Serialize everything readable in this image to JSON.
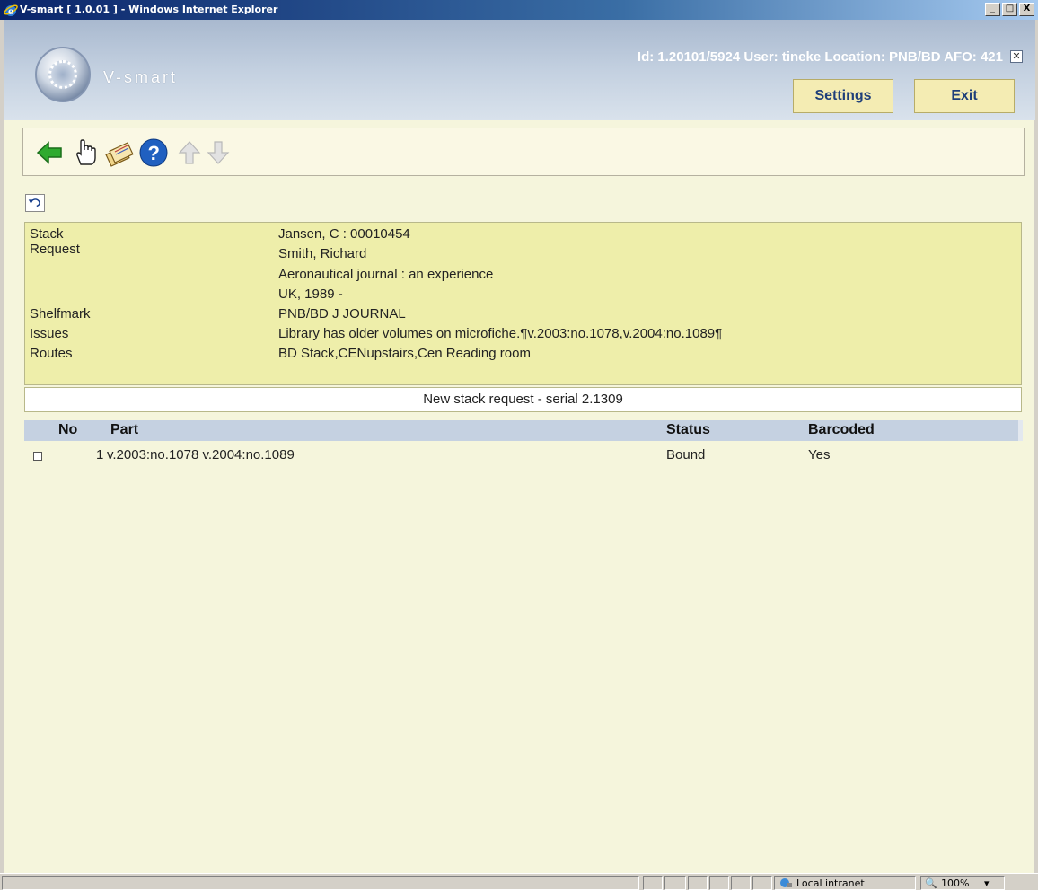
{
  "window": {
    "title": "V-smart [ 1.0.01 ] - Windows Internet Explorer",
    "min_label": "_",
    "max_label": "□",
    "close_label": "X"
  },
  "header": {
    "app_name": "V-smart",
    "session_info": "Id: 1.20101/5924   User: tineke   Location: PNB/BD   AFO: 421",
    "close_label": "✕",
    "settings_label": "Settings",
    "exit_label": "Exit"
  },
  "toolbar": {
    "icons": [
      "back-arrow-icon",
      "hand-pointer-icon",
      "request-slips-icon",
      "help-icon",
      "up-arrow-icon",
      "down-arrow-icon"
    ]
  },
  "info": {
    "rows": [
      {
        "label": "Stack Request",
        "value": "Jansen, C : 00010454"
      },
      {
        "label": "",
        "value": "Smith, Richard"
      },
      {
        "label": "",
        "value": "Aeronautical journal : an experience"
      },
      {
        "label": "",
        "value": "UK, 1989 -"
      },
      {
        "label": "Shelfmark",
        "value": "PNB/BD J JOURNAL"
      },
      {
        "label": "Issues",
        "value": "Library has older volumes on microfiche.¶v.2003:no.1078,v.2004:no.1089¶"
      },
      {
        "label": "Routes",
        "value": "BD Stack,CENupstairs,Cen Reading room"
      }
    ]
  },
  "caption": "New stack request - serial 2.1309",
  "table": {
    "columns": [
      "No",
      "Part",
      "Status",
      "Barcoded"
    ],
    "rows": [
      {
        "no": "1",
        "part": "v.2003:no.1078 v.2004:no.1089",
        "status": "Bound",
        "barcoded": "Yes"
      }
    ]
  },
  "statusbar": {
    "zone": "Local intranet",
    "zoom": "100%",
    "zoom_dropdown": "▾"
  },
  "colors": {
    "info_bg": "#eeeeaa",
    "table_header_bg": "#c5d1e1",
    "button_bg": "#f4ecb3",
    "button_text": "#1e3f7a"
  }
}
